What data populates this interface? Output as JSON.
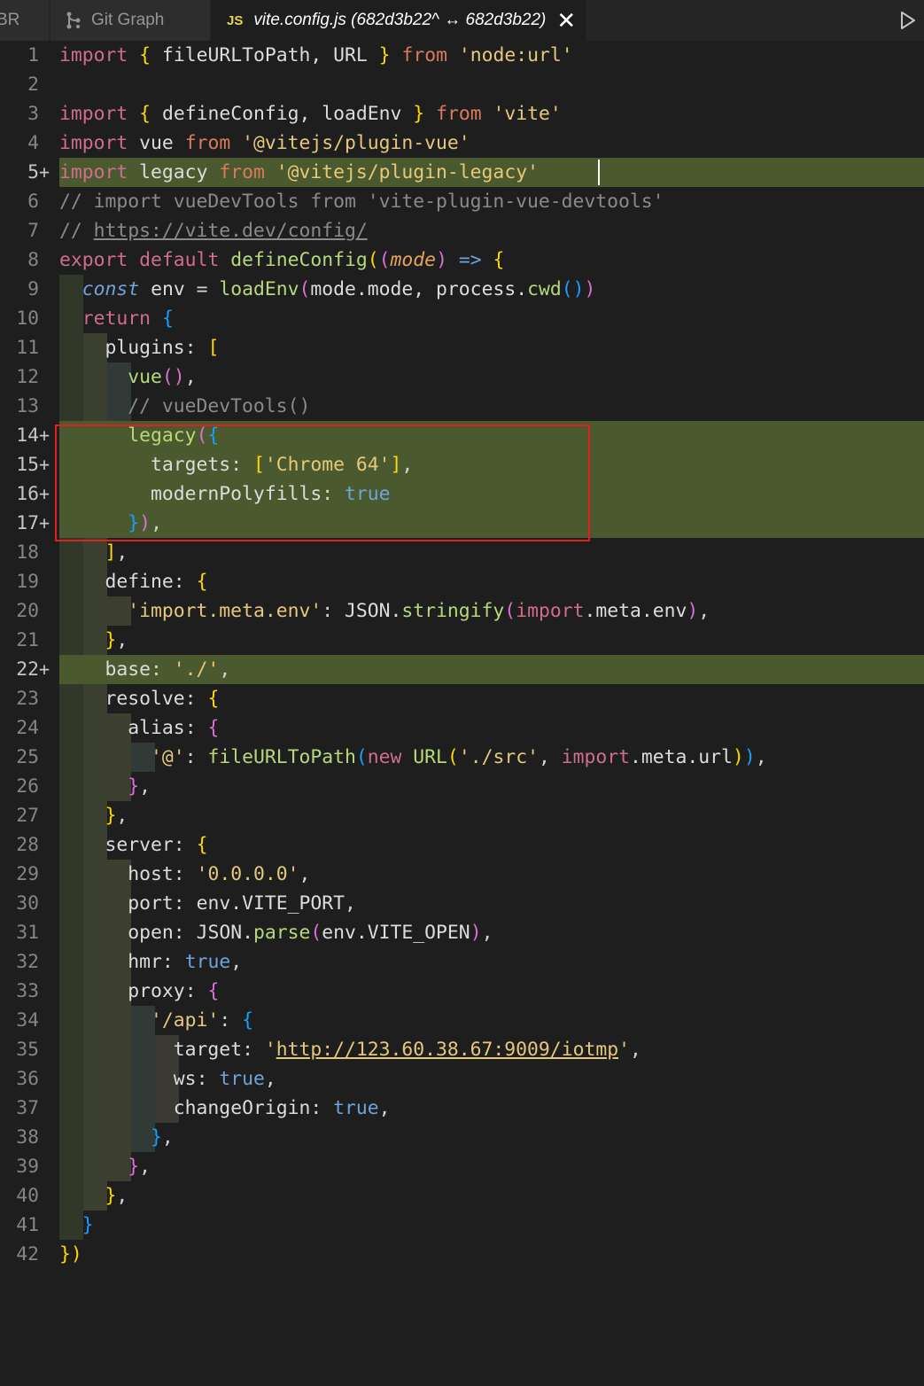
{
  "tabs": [
    {
      "label": "BR",
      "active": false
    },
    {
      "label": "Git Graph",
      "icon": "git-graph-icon",
      "active": false
    },
    {
      "label": "vite.config.js (682d3b22^ ↔ 682d3b22)",
      "icon": "js-file-icon",
      "icon_text": "JS",
      "active": true
    }
  ],
  "tab_close_symbol": "✕",
  "editor": {
    "file": "vite.config.js",
    "lines": [
      {
        "n": "1",
        "diff": "",
        "text": "import { fileURLToPath, URL } from 'node:url'"
      },
      {
        "n": "2",
        "diff": "",
        "text": ""
      },
      {
        "n": "3",
        "diff": "",
        "text": "import { defineConfig, loadEnv } from 'vite'"
      },
      {
        "n": "4",
        "diff": "",
        "text": "import vue from '@vitejs/plugin-vue'"
      },
      {
        "n": "5",
        "diff": "+",
        "text": "import legacy from '@vitejs/plugin-legacy'"
      },
      {
        "n": "6",
        "diff": "",
        "text": "// import vueDevTools from 'vite-plugin-vue-devtools'"
      },
      {
        "n": "7",
        "diff": "",
        "text": "// https://vite.dev/config/"
      },
      {
        "n": "8",
        "diff": "",
        "text": "export default defineConfig((mode) => {"
      },
      {
        "n": "9",
        "diff": "",
        "text": "  const env = loadEnv(mode.mode, process.cwd())"
      },
      {
        "n": "10",
        "diff": "",
        "text": "  return {"
      },
      {
        "n": "11",
        "diff": "",
        "text": "    plugins: ["
      },
      {
        "n": "12",
        "diff": "",
        "text": "      vue(),"
      },
      {
        "n": "13",
        "diff": "",
        "text": "      // vueDevTools()"
      },
      {
        "n": "14",
        "diff": "+",
        "text": "      legacy({"
      },
      {
        "n": "15",
        "diff": "+",
        "text": "        targets: ['Chrome 64'],"
      },
      {
        "n": "16",
        "diff": "+",
        "text": "        modernPolyfills: true"
      },
      {
        "n": "17",
        "diff": "+",
        "text": "      }),"
      },
      {
        "n": "18",
        "diff": "",
        "text": "    ],"
      },
      {
        "n": "19",
        "diff": "",
        "text": "    define: {"
      },
      {
        "n": "20",
        "diff": "",
        "text": "      'import.meta.env': JSON.stringify(import.meta.env),"
      },
      {
        "n": "21",
        "diff": "",
        "text": "    },"
      },
      {
        "n": "22",
        "diff": "+",
        "text": "    base: './',"
      },
      {
        "n": "23",
        "diff": "",
        "text": "    resolve: {"
      },
      {
        "n": "24",
        "diff": "",
        "text": "      alias: {"
      },
      {
        "n": "25",
        "diff": "",
        "text": "        '@': fileURLToPath(new URL('./src', import.meta.url)),"
      },
      {
        "n": "26",
        "diff": "",
        "text": "      },"
      },
      {
        "n": "27",
        "diff": "",
        "text": "    },"
      },
      {
        "n": "28",
        "diff": "",
        "text": "    server: {"
      },
      {
        "n": "29",
        "diff": "",
        "text": "      host: '0.0.0.0',"
      },
      {
        "n": "30",
        "diff": "",
        "text": "      port: env.VITE_PORT,"
      },
      {
        "n": "31",
        "diff": "",
        "text": "      open: JSON.parse(env.VITE_OPEN),"
      },
      {
        "n": "32",
        "diff": "",
        "text": "      hmr: true,"
      },
      {
        "n": "33",
        "diff": "",
        "text": "      proxy: {"
      },
      {
        "n": "34",
        "diff": "",
        "text": "        '/api': {"
      },
      {
        "n": "35",
        "diff": "",
        "text": "          target: 'http://123.60.38.67:9009/iotmp',"
      },
      {
        "n": "36",
        "diff": "",
        "text": "          ws: true,"
      },
      {
        "n": "37",
        "diff": "",
        "text": "          changeOrigin: true,"
      },
      {
        "n": "38",
        "diff": "",
        "text": "        },"
      },
      {
        "n": "39",
        "diff": "",
        "text": "      },"
      },
      {
        "n": "40",
        "diff": "",
        "text": "    },"
      },
      {
        "n": "41",
        "diff": "",
        "text": "  }"
      },
      {
        "n": "42",
        "diff": "",
        "text": "})"
      }
    ]
  },
  "colors": {
    "editor_bg": "#1e1e1e",
    "added_line_bg": "#4b5a2e",
    "annotation_box": "#e02020",
    "keyword": "#d16c8f",
    "string": "#e6c87a",
    "function": "#b5d97a",
    "comment": "#8a8a8a"
  }
}
